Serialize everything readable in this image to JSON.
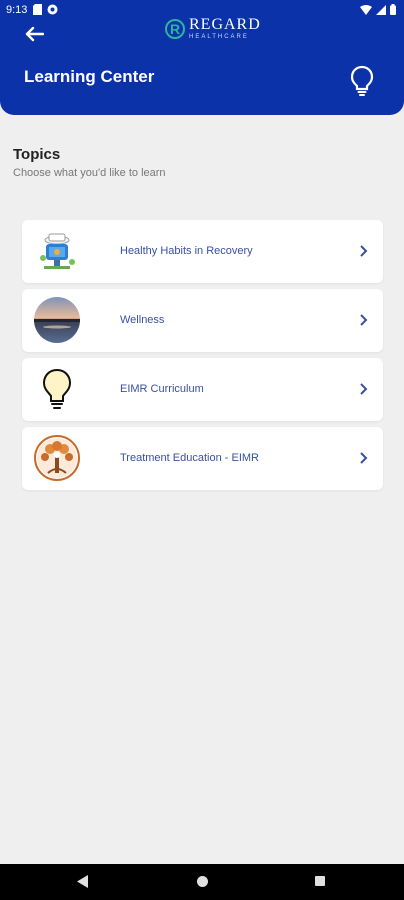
{
  "status_bar": {
    "time": "9:13"
  },
  "header": {
    "logo_letter": "R",
    "logo_name": "REGARD",
    "logo_sub": "HEALTHCARE",
    "title": "Learning Center"
  },
  "section": {
    "title": "Topics",
    "subtitle": "Choose what you'd like to learn"
  },
  "topics": [
    {
      "label": "Healthy Habits in Recovery",
      "icon": "healthy-habits-thumbnail"
    },
    {
      "label": "Wellness",
      "icon": "wellness-sunset-thumbnail"
    },
    {
      "label": "EIMR Curriculum",
      "icon": "lightbulb-thumbnail"
    },
    {
      "label": "Treatment Education - EIMR",
      "icon": "tree-people-thumbnail"
    }
  ],
  "colors": {
    "primary": "#0b32a8",
    "accent": "#2bb3a4",
    "label": "#3a4fa3",
    "background": "#efefef"
  }
}
